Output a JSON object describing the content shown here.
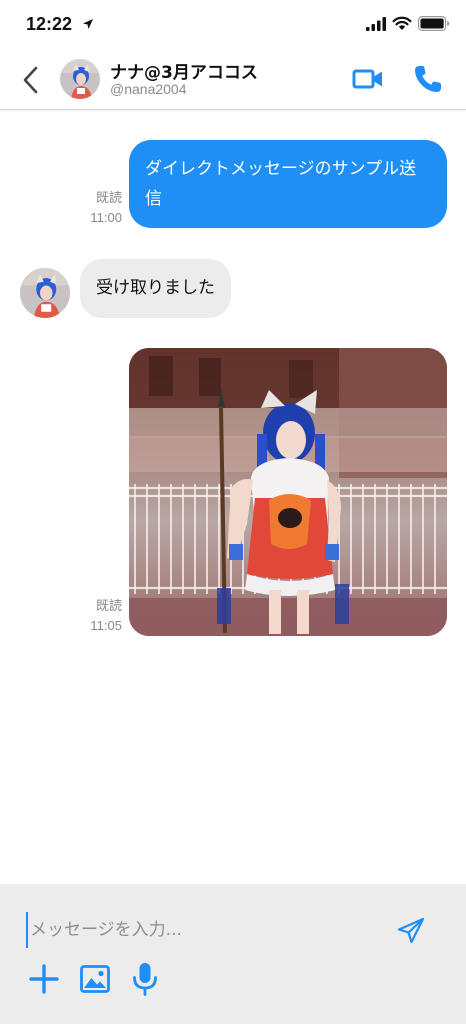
{
  "status_bar": {
    "time": "12:22"
  },
  "header": {
    "name": "ナナ@3月アココス",
    "handle": "@nana2004"
  },
  "messages": [
    {
      "type": "sent",
      "text": "ダイレクトメッセージのサンプル送信",
      "read_label": "既読",
      "time": "11:00"
    },
    {
      "type": "received",
      "text": "受け取りました"
    },
    {
      "type": "sent-image",
      "read_label": "既読",
      "time": "11:05"
    }
  ],
  "composer": {
    "placeholder": "メッセージを入力..."
  },
  "colors": {
    "accent": "#1f8ff5",
    "received_bubble": "#ececec",
    "composer_bg": "#ececec"
  }
}
